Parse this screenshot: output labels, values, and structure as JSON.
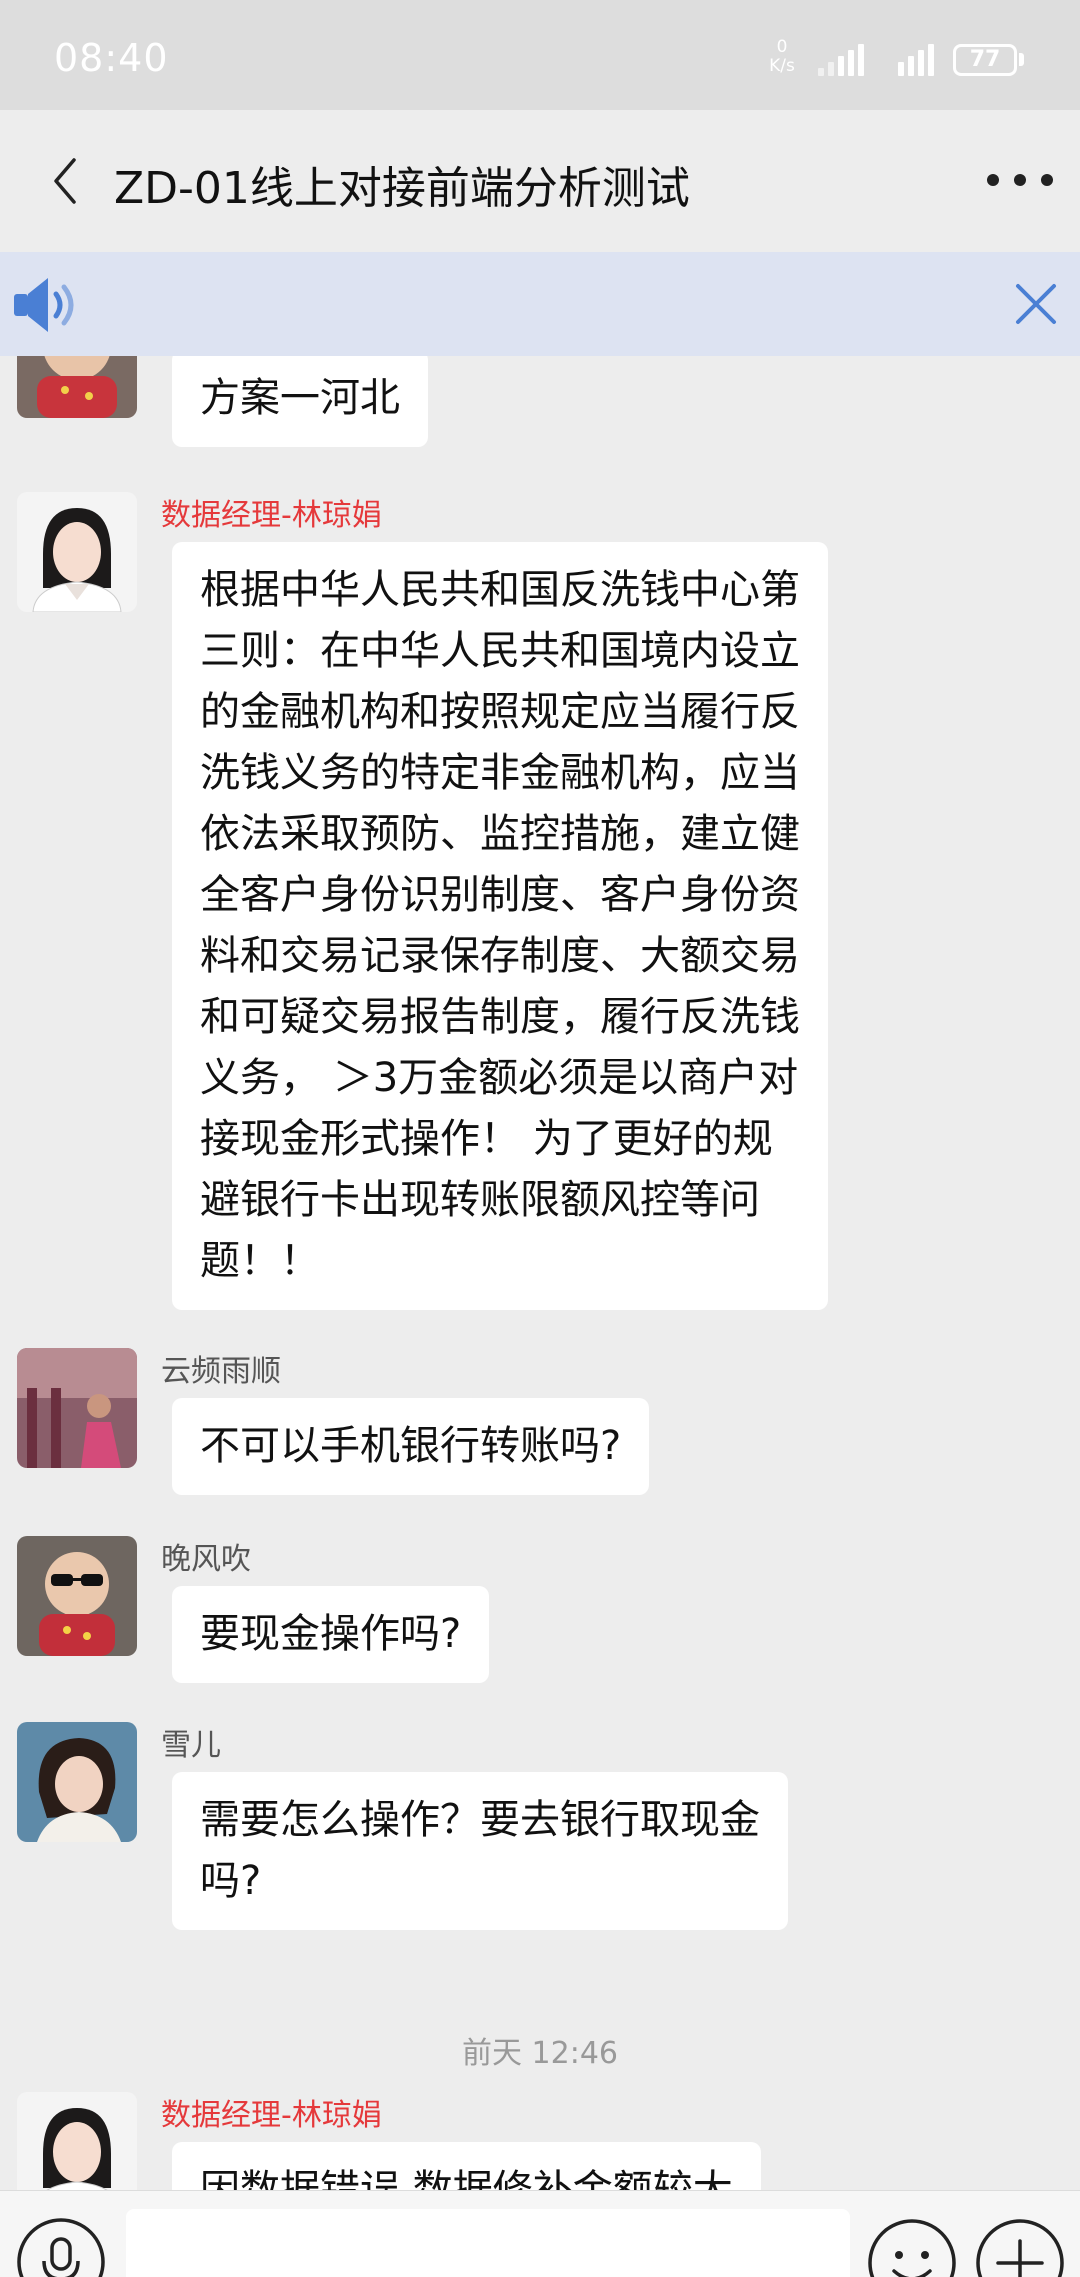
{
  "status_bar": {
    "time": "08:40",
    "net_speed_value": "0",
    "net_speed_unit": "K/s",
    "battery": "77"
  },
  "header": {
    "title": "ZD-01线上对接前端分析测试",
    "back_icon": "chevron-left-icon",
    "more_icon": "more-horizontal-icon"
  },
  "voice_banner": {
    "speaker_icon": "speaker-icon",
    "close_icon": "close-icon"
  },
  "messages": [
    {
      "sender": "",
      "lines": [
        "方案一河北"
      ]
    },
    {
      "sender": "数据经理-林琼娟",
      "lines": [
        "根据中华人民共和国反洗钱中心第",
        "三则：在中华人民共和国境内设立",
        "的金融机构和按照规定应当履行反",
        "洗钱义务的特定非金融机构，应当",
        "依法采取预防、监控措施，建立健",
        "全客户身份识别制度、客户身份资",
        "料和交易记录保存制度、大额交易",
        "和可疑交易报告制度，履行反洗钱",
        "义务， ＞3万金额必须是以商户对",
        "接现金形式操作！ 为了更好的规",
        "避银行卡出现转账限额风控等问",
        "题！！"
      ]
    },
    {
      "sender": "云频雨顺",
      "lines": [
        "不可以手机银行转账吗?"
      ]
    },
    {
      "sender": "晚风吹",
      "lines": [
        "要现金操作吗?"
      ]
    },
    {
      "sender": "雪儿",
      "lines": [
        "需要怎么操作？要去银行取现金",
        "吗?"
      ]
    },
    {
      "sender": "数据经理-林琼娟",
      "lines": [
        "因数据错误 数据修补金额较大"
      ]
    }
  ],
  "timestamp": "前天 12:46",
  "input_bar": {
    "voice_icon": "microphone-icon",
    "placeholder": "",
    "emoji_icon": "smiley-icon",
    "plus_icon": "plus-icon"
  },
  "colors": {
    "status_bar_bg": "#dddddd",
    "header_bg": "#ededed",
    "banner_bg": "#dde3f2",
    "accent_blue": "#4a7fd4",
    "sender_red": "#e5393b",
    "bubble_bg": "#ffffff"
  }
}
